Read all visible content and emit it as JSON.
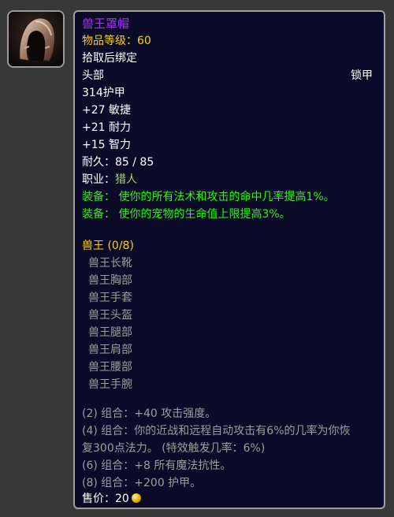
{
  "item": {
    "name": "兽王罩帽",
    "item_level": "物品等级：60",
    "bind": "拾取后绑定",
    "slot": "头部",
    "armor_type": "锁甲",
    "armor": "314护甲",
    "stats": [
      "+27 敏捷",
      "+21 耐力",
      "+15 智力"
    ],
    "durability": "耐久：85 / 85",
    "class_label": "职业：",
    "class_value": "猎人",
    "equip": [
      {
        "label": "装备：",
        "text": "使你的所有法术和攻击的命中几率提高1%。"
      },
      {
        "label": "装备：",
        "text": "使你的宠物的生命值上限提高3%。"
      }
    ],
    "set_name": "兽王 (0/8)",
    "set_pieces": [
      "兽王长靴",
      "兽王胸部",
      "兽王手套",
      "兽王头盔",
      "兽王腿部",
      "兽王肩部",
      "兽王腰部",
      "兽王手腕"
    ],
    "set_bonuses": [
      "(2) 组合：+40 攻击强度。",
      "(4) 组合：你的近战和远程自动攻击有6%的几率为你恢",
      "复300点法力。 (特效触发几率：6%)",
      "(6) 组合：+8 所有魔法抗性。",
      "(8) 组合：+200 护甲。"
    ],
    "sell_label": "售价：",
    "sell_value": "20"
  },
  "icon": "hooded-helm-icon",
  "colors": {
    "epic": "#a335ee",
    "green": "#1eff00",
    "grey": "#9d9d9d",
    "yellow": "#ffd100",
    "hunter": "#abd473"
  }
}
